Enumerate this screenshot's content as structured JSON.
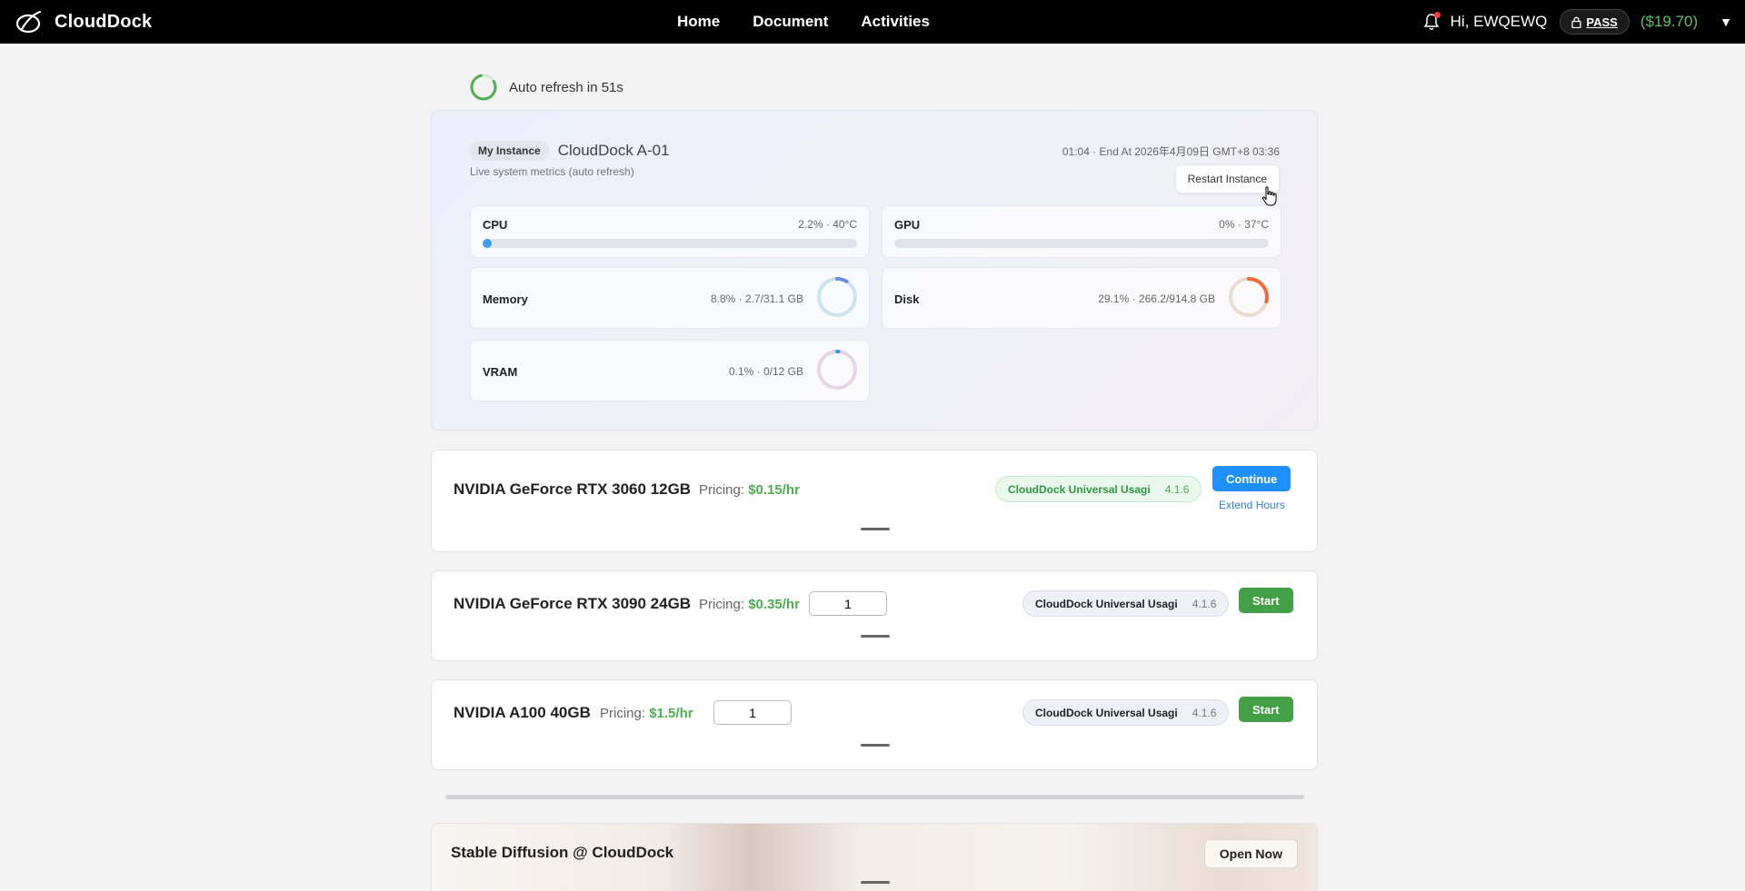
{
  "nav": {
    "brand": "CloudDock",
    "links": [
      "Home",
      "Document",
      "Activities"
    ],
    "greeting": "Hi, EWQEWQ",
    "pass_label": "PASS",
    "balance": "($19.70)",
    "menu_caret": "▼"
  },
  "refresh": {
    "text": "Auto refresh in 51s"
  },
  "instance": {
    "tag": "My Instance",
    "name": "CloudDock A-01",
    "subtitle": "Live system metrics (auto refresh)",
    "end_info": "01:04 · End At 2026年4月09日 GMT+8 03:36",
    "restart_label": "Restart Instance",
    "metrics": {
      "cpu": {
        "label": "CPU",
        "value": "2.2% · 40°C",
        "percent": 2.2
      },
      "gpu": {
        "label": "GPU",
        "value": "0% · 37°C",
        "percent": 0
      },
      "memory": {
        "label": "Memory",
        "value": "8.8% · 2.7/31.1 GB",
        "percent": 8.8,
        "color": "#6a8fd8",
        "track": "#c9e4ef"
      },
      "disk": {
        "label": "Disk",
        "value": "29.1% · 266.2/914.8 GB",
        "percent": 29.1,
        "color": "#f26b3a",
        "track": "#e9dcd3"
      },
      "vram": {
        "label": "VRAM",
        "value": "0.1% · 0/12 GB",
        "percent": 0.1,
        "color": "#3b9cf0",
        "track": "#e5d6e6"
      }
    }
  },
  "gpus": [
    {
      "name": "NVIDIA GeForce RTX 3060 12GB",
      "pricing_label": "Pricing:",
      "price": "$0.15/hr",
      "image": "CloudDock Universal Usagi",
      "version": "4.1.6",
      "action": "Continue",
      "extend": "Extend Hours"
    },
    {
      "name": "NVIDIA GeForce RTX 3090 24GB",
      "pricing_label": "Pricing:",
      "price": "$0.35/hr",
      "qty": "1",
      "image": "CloudDock Universal Usagi",
      "version": "4.1.6",
      "action": "Start"
    },
    {
      "name": "NVIDIA A100 40GB",
      "pricing_label": "Pricing:",
      "price": "$1.5/hr",
      "qty": "1",
      "image": "CloudDock Universal Usagi",
      "version": "4.1.6",
      "action": "Start"
    }
  ],
  "sd": {
    "title": "Stable Diffusion @ CloudDock",
    "open_label": "Open Now"
  },
  "colors": {
    "accent_green": "#4caf50",
    "continue_blue": "#1e90ff",
    "nav_bg": "#000000"
  }
}
